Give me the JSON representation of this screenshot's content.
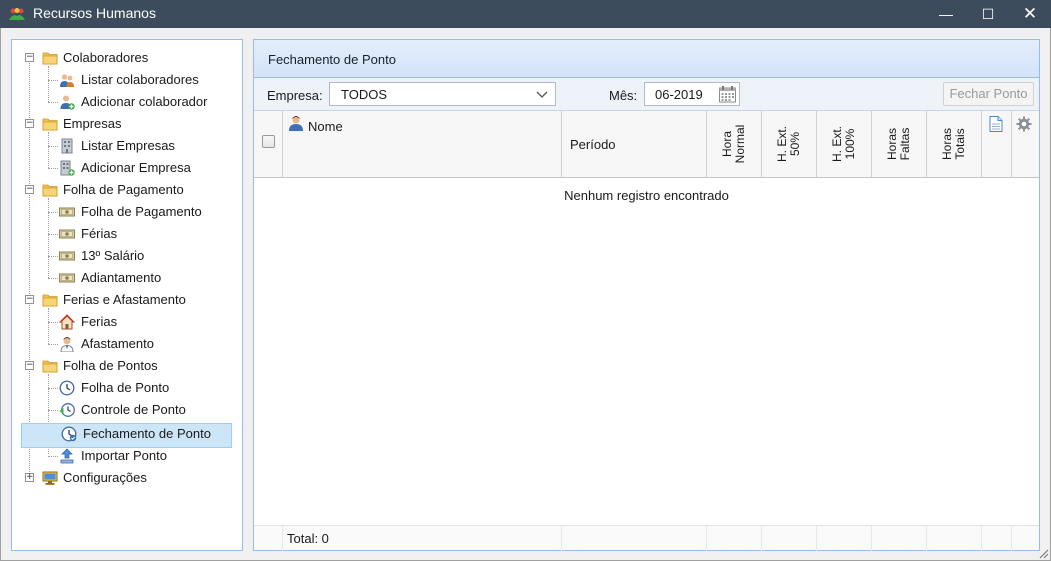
{
  "window": {
    "title": "Recursos Humanos",
    "minimize": "—",
    "maximize": "☐",
    "close": "✕"
  },
  "tree": {
    "groups": [
      {
        "label": "Colaboradores",
        "toggle": "−",
        "items": [
          {
            "label": "Listar colaboradores",
            "icon": "users-icon"
          },
          {
            "label": "Adicionar colaborador",
            "icon": "user-add-icon"
          }
        ]
      },
      {
        "label": "Empresas",
        "toggle": "−",
        "items": [
          {
            "label": "Listar Empresas",
            "icon": "building-icon"
          },
          {
            "label": "Adicionar Empresa",
            "icon": "building-add-icon"
          }
        ]
      },
      {
        "label": "Folha de Pagamento",
        "toggle": "−",
        "items": [
          {
            "label": "Folha de Pagamento",
            "icon": "money-icon"
          },
          {
            "label": "Férias",
            "icon": "money-icon"
          },
          {
            "label": "13º Salário",
            "icon": "money-icon"
          },
          {
            "label": "Adiantamento",
            "icon": "money-icon"
          }
        ]
      },
      {
        "label": "Ferias e Afastamento",
        "toggle": "−",
        "items": [
          {
            "label": "Ferias",
            "icon": "house-icon"
          },
          {
            "label": "Afastamento",
            "icon": "person-icon"
          }
        ]
      },
      {
        "label": "Folha de Pontos",
        "toggle": "−",
        "items": [
          {
            "label": "Folha de Ponto",
            "icon": "clock-icon"
          },
          {
            "label": "Controle de Ponto",
            "icon": "clock-arrow-icon"
          },
          {
            "label": "Fechamento de Ponto",
            "icon": "clock-check-icon",
            "selected": true
          },
          {
            "label": "Importar Ponto",
            "icon": "upload-icon"
          }
        ]
      },
      {
        "label": "Configurações",
        "toggle": "+",
        "items": []
      }
    ]
  },
  "panel": {
    "title": "Fechamento de Ponto",
    "toolbar": {
      "empresa_label": "Empresa:",
      "empresa_value": "TODOS",
      "mes_label": "Mês:",
      "mes_value": "06-2019",
      "fechar_button": "Fechar Ponto"
    },
    "columns": {
      "nome": "Nome",
      "periodo": "Período",
      "hora_normal": [
        "Hora",
        "Normal"
      ],
      "hext50": [
        "H. Ext.",
        "50%"
      ],
      "hext100": [
        "H. Ext.",
        "100%"
      ],
      "horas_faltas": [
        "Horas",
        "Faltas"
      ],
      "horas_totais": [
        "Horas",
        "Totais"
      ]
    },
    "empty_message": "Nenhum registro encontrado",
    "footer_total": "Total: 0"
  },
  "colors": {
    "titlebar": "#3c4c5c",
    "panel_border": "#99bbe8",
    "selected_bg": "#cde6f7",
    "folder": "#f2c14e"
  }
}
